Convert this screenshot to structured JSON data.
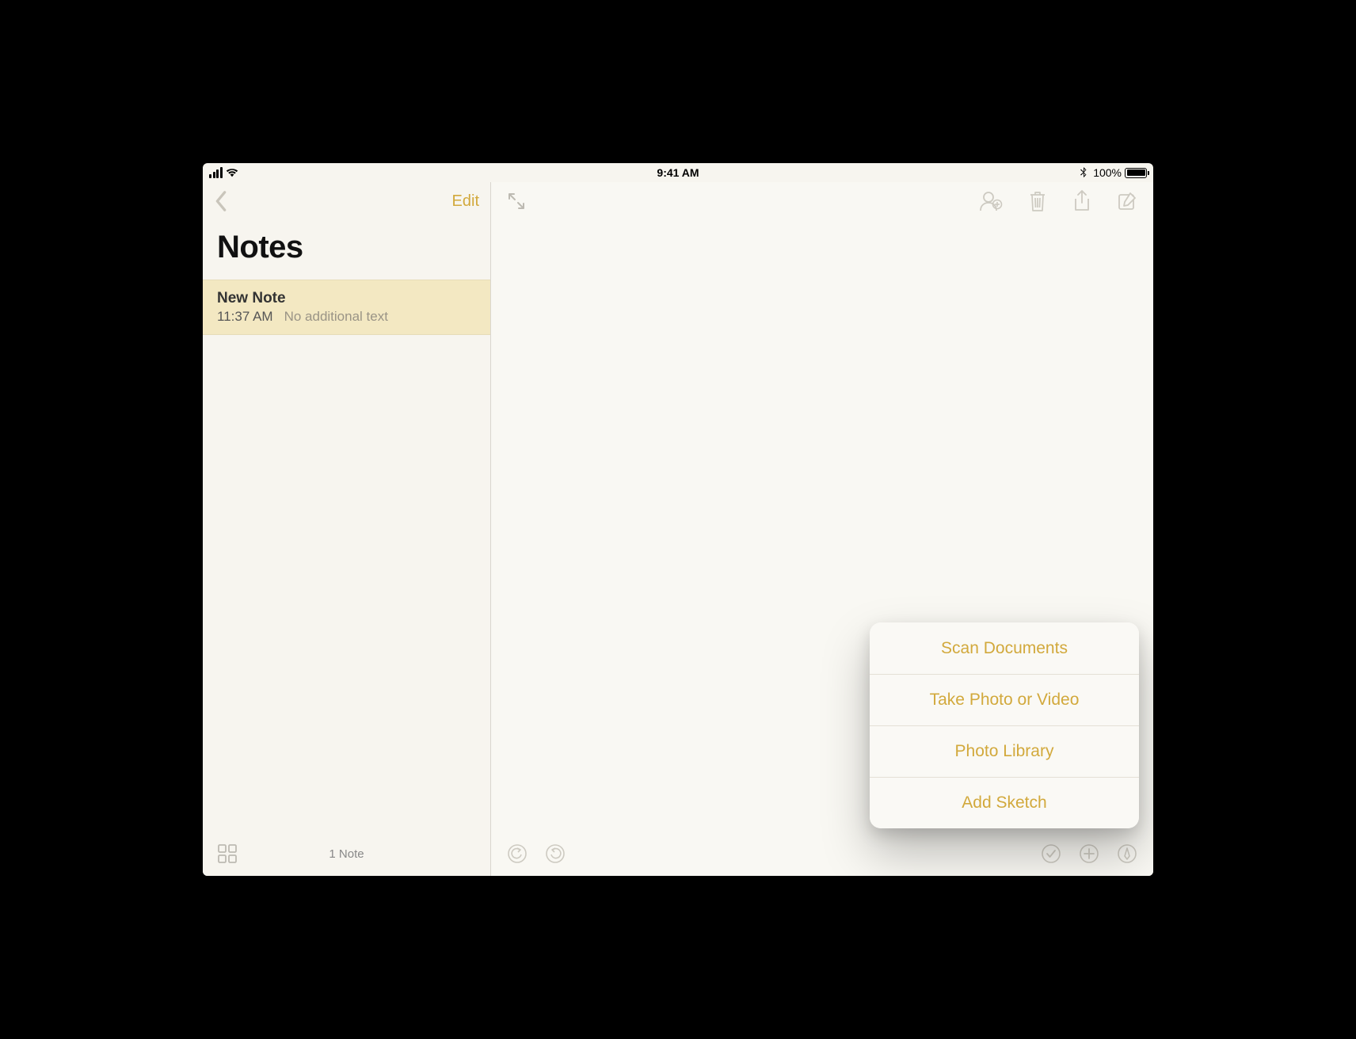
{
  "status": {
    "time": "9:41 AM",
    "battery_pct": "100%"
  },
  "sidebar": {
    "edit_label": "Edit",
    "title": "Notes",
    "notes": [
      {
        "title": "New Note",
        "time": "11:37 AM",
        "snippet": "No additional text"
      }
    ],
    "footer_count": "1 Note"
  },
  "popover": {
    "items": [
      "Scan Documents",
      "Take Photo or Video",
      "Photo Library",
      "Add Sketch"
    ]
  },
  "colors": {
    "accent": "#d2a93c",
    "icon_inactive": "#bdbab2",
    "selected_bg": "#f3e8c2"
  }
}
